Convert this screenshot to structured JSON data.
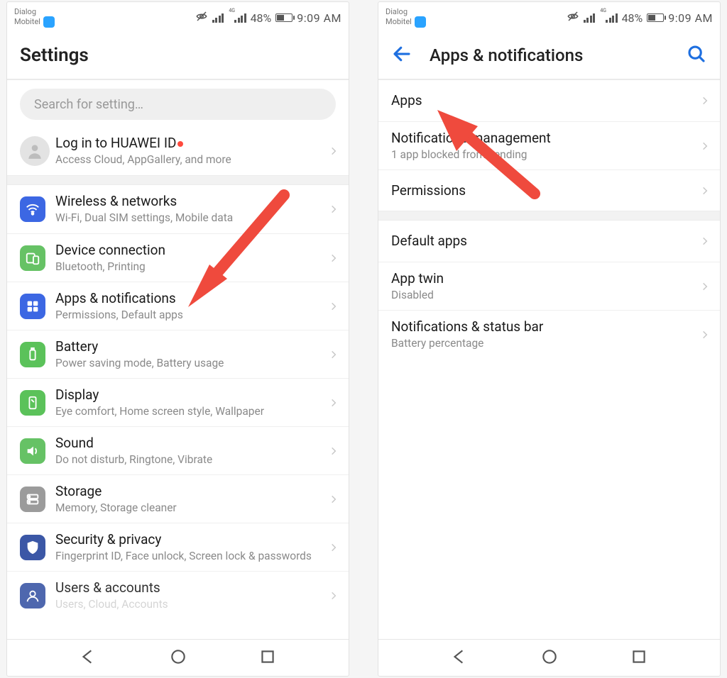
{
  "status": {
    "carrier_top": "Dialog",
    "carrier_bot": "Mobitel",
    "battery_pct": "48%",
    "time": "9:09 AM"
  },
  "left": {
    "title": "Settings",
    "search_placeholder": "Search for setting…",
    "login": {
      "title": "Log in to HUAWEI ID",
      "sub": "Access Cloud, AppGallery, and more"
    },
    "items": [
      {
        "title": "Wireless & networks",
        "sub": "Wi-Fi, Dual SIM settings, Mobile data",
        "icon": "wifi",
        "color": "c-blue"
      },
      {
        "title": "Device connection",
        "sub": "Bluetooth, Printing",
        "icon": "device",
        "color": "c-green"
      },
      {
        "title": "Apps & notifications",
        "sub": "Permissions, Default apps",
        "icon": "apps",
        "color": "c-blue"
      },
      {
        "title": "Battery",
        "sub": "Power saving mode, Battery usage",
        "icon": "battery",
        "color": "c-green2"
      },
      {
        "title": "Display",
        "sub": "Eye comfort, Home screen style, Wallpaper",
        "icon": "display",
        "color": "c-green2"
      },
      {
        "title": "Sound",
        "sub": "Do not disturb, Ringtone, Vibrate",
        "icon": "sound",
        "color": "c-green"
      },
      {
        "title": "Storage",
        "sub": "Memory, Storage cleaner",
        "icon": "storage",
        "color": "c-grey"
      },
      {
        "title": "Security & privacy",
        "sub": "Fingerprint ID, Face unlock, Screen lock & passwords",
        "icon": "shield",
        "color": "c-dblue"
      },
      {
        "title": "Users & accounts",
        "sub": "Users, Cloud, Accounts",
        "icon": "user",
        "color": "c-dblue"
      }
    ]
  },
  "right": {
    "title": "Apps & notifications",
    "group1": [
      {
        "title": "Apps",
        "sub": ""
      },
      {
        "title": "Notifications management",
        "sub": "1 app blocked from sending"
      },
      {
        "title": "Permissions",
        "sub": ""
      }
    ],
    "group2": [
      {
        "title": "Default apps",
        "sub": ""
      },
      {
        "title": "App twin",
        "sub": "Disabled"
      },
      {
        "title": "Notifications & status bar",
        "sub": "Battery percentage"
      }
    ]
  }
}
